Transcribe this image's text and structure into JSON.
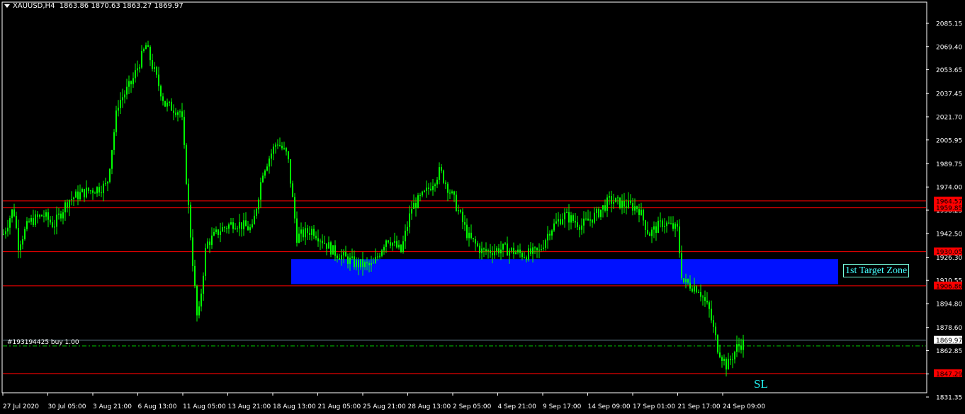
{
  "header": {
    "symbol": "XAUUSD,H4",
    "ohlc": "1863.86 1870.63 1863.27 1869.97"
  },
  "price_axis": {
    "ticks": [
      "2085.15",
      "2069.40",
      "2053.65",
      "2037.45",
      "2021.70",
      "2005.95",
      "1989.75",
      "1974.00",
      "1958.25",
      "1942.50",
      "1926.30",
      "1910.55",
      "1894.80",
      "1878.60",
      "1862.85",
      "1847.10",
      "1831.35"
    ],
    "min": 1831.35,
    "max": 2085.15
  },
  "time_axis": {
    "labels": [
      "27 Jul 2020",
      "30 Jul 05:00",
      "3 Aug 21:00",
      "6 Aug 13:00",
      "11 Aug 05:00",
      "13 Aug 21:00",
      "18 Aug 13:00",
      "21 Aug 05:00",
      "25 Aug 21:00",
      "28 Aug 13:00",
      "2 Sep 05:00",
      "4 Sep 21:00",
      "9 Sep 17:00",
      "14 Sep 09:00",
      "17 Sep 01:00",
      "21 Sep 17:00",
      "24 Sep 09:00"
    ]
  },
  "levels": [
    {
      "price": 1964.57,
      "label": "1964.57",
      "color": "#ff0000"
    },
    {
      "price": 1959.85,
      "label": "1959.85",
      "color": "#ff0000"
    },
    {
      "price": 1930.05,
      "label": "1930.05",
      "color": "#ff0000"
    },
    {
      "price": 1906.86,
      "label": "1906.86",
      "color": "#ff0000"
    },
    {
      "price": 1847.29,
      "label": "1847.29",
      "color": "#ff0000"
    }
  ],
  "current_price": {
    "price": 1869.97,
    "label": "1869.97"
  },
  "order": {
    "price": 1866.0,
    "label": "#193194425 buy 1.00"
  },
  "target_zone": {
    "top": 1925.0,
    "bottom": 1908.0,
    "label": "1st Target Zone",
    "color": "#0011ff"
  },
  "sl_label": "SL",
  "colors": {
    "candle": "#00ff00",
    "background": "#000000",
    "axis_text": "#ffffff"
  },
  "chart_data": {
    "type": "line",
    "title": "XAUUSD,H4",
    "xlabel": "",
    "ylabel": "",
    "ylim": [
      1831.35,
      2085.15
    ],
    "x": [
      "27 Jul 2020",
      "30 Jul 05:00",
      "3 Aug 21:00",
      "6 Aug 13:00",
      "11 Aug 05:00",
      "13 Aug 21:00",
      "18 Aug 13:00",
      "21 Aug 05:00",
      "25 Aug 21:00",
      "28 Aug 13:00",
      "2 Sep 05:00",
      "4 Sep 21:00",
      "9 Sep 17:00",
      "14 Sep 09:00",
      "17 Sep 01:00",
      "21 Sep 17:00",
      "24 Sep 09:00"
    ],
    "series": [
      {
        "name": "XAUUSD,H4",
        "values": [
          1945,
          1952,
          1976,
          2062,
          1880,
          1948,
          2005,
          1940,
          1930,
          1968,
          1940,
          1935,
          1948,
          1960,
          1950,
          1908,
          1862
        ]
      }
    ]
  }
}
